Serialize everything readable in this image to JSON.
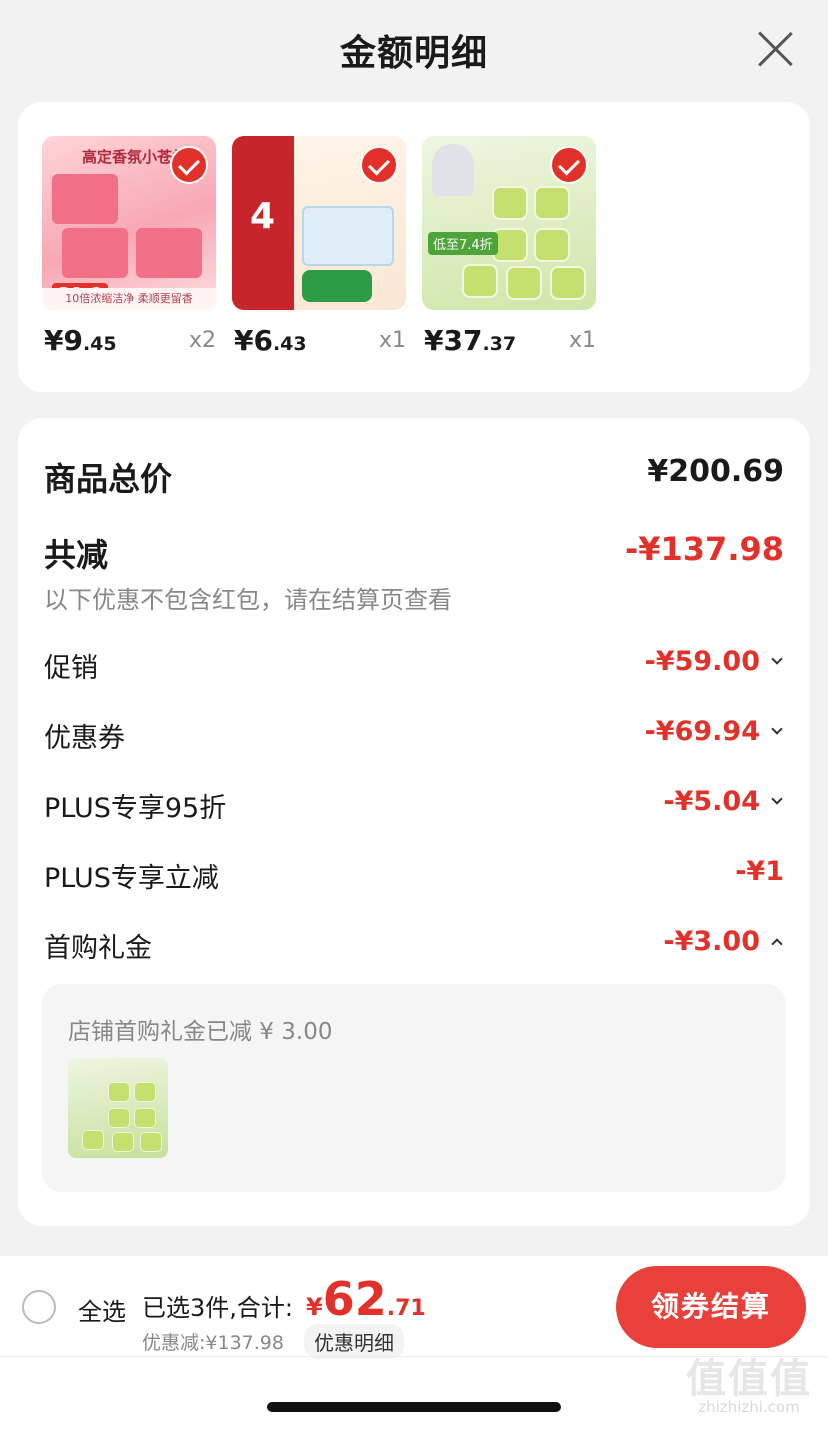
{
  "header": {
    "title": "金额明细"
  },
  "products": [
    {
      "int": "¥9",
      "dec": ".45",
      "qty": "x2",
      "img_text": "高定香氛小苍兰",
      "img_tag": "39.8",
      "img_band": "10倍浓缩洁净 柔顺更留香"
    },
    {
      "int": "¥6",
      "dec": ".43",
      "qty": "x1",
      "img_text": "4"
    },
    {
      "int": "¥37",
      "dec": ".37",
      "qty": "x1",
      "img_text": "低至7.4折"
    }
  ],
  "summary": {
    "total_label": "商品总价",
    "total_value": "¥200.69",
    "reduce_label": "共减",
    "reduce_value": "-¥137.98",
    "note": "以下优惠不包含红包，请在结算页查看"
  },
  "discounts": [
    {
      "label": "促销",
      "value": "-¥59.00",
      "chevron": "chevron-down-icon"
    },
    {
      "label": "优惠券",
      "value": "-¥69.94",
      "chevron": "chevron-down-icon"
    },
    {
      "label": "PLUS专享95折",
      "value": "-¥5.04",
      "chevron": "chevron-down-icon"
    },
    {
      "label": "PLUS专享立减",
      "value": "-¥1"
    },
    {
      "label": "首购礼金",
      "value": "-¥3.00",
      "chevron": "chevron-up-icon"
    }
  ],
  "gift_detail": {
    "text": "店铺首购礼金已减 ¥ 3.00"
  },
  "bottom_bar": {
    "select_all": "全选",
    "selected": "已选3件,合计:",
    "currency": "¥",
    "total_int": "62",
    "total_dec": ".71",
    "saved": "优惠减:¥137.98",
    "detail_pill": "优惠明细",
    "pay_button": "领券结算"
  },
  "watermark": {
    "logo": "值值值",
    "site": "zhizhizhi.com"
  },
  "colors": {
    "accent_red": "#e2312a",
    "pay_button": "#e8413c"
  }
}
